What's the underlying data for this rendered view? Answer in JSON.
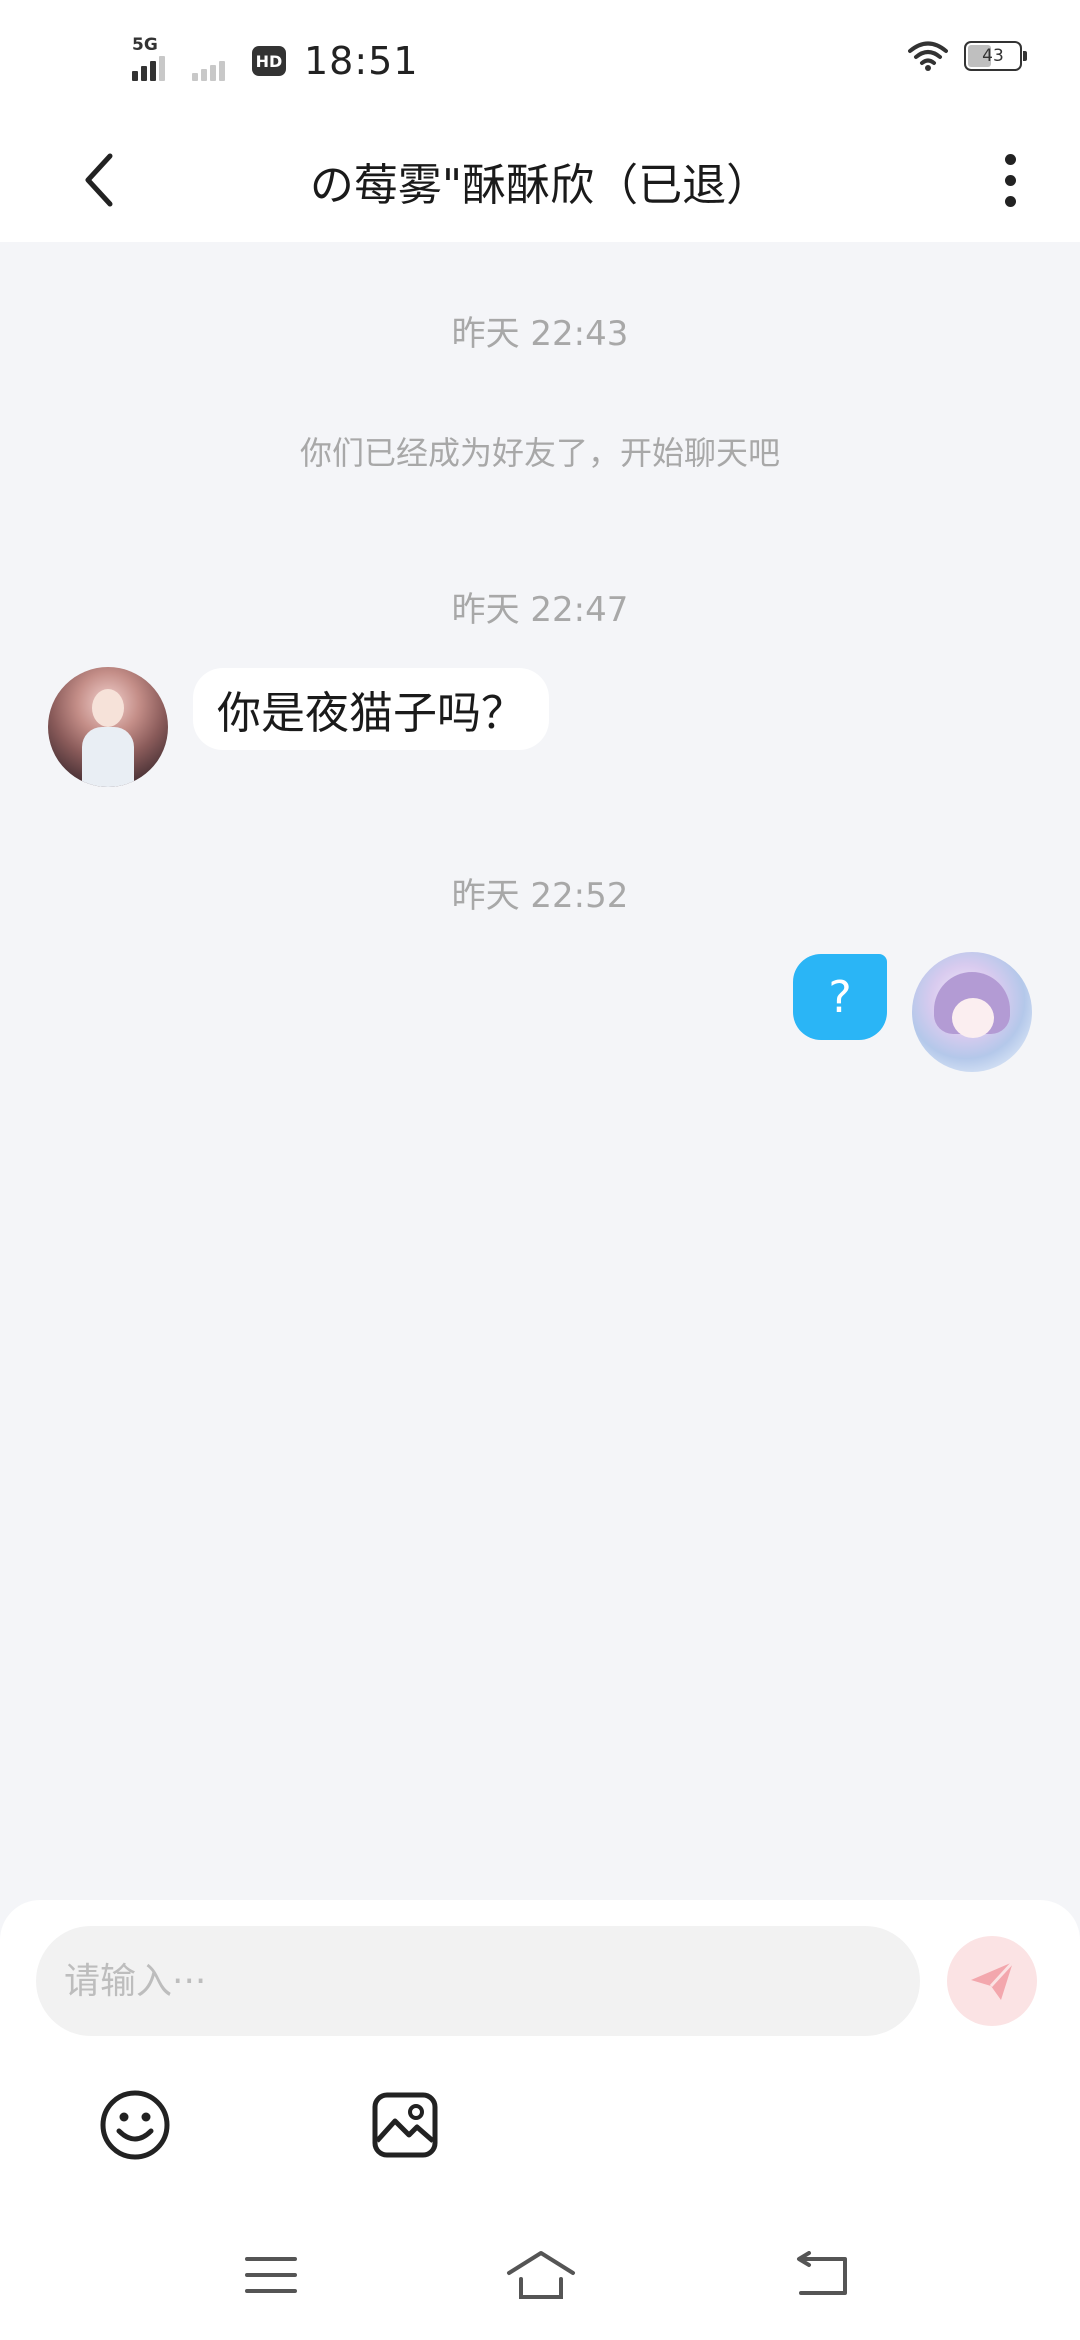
{
  "status_bar": {
    "network_label": "5G",
    "hd_label": "HD",
    "time": "18:51",
    "battery_level": "43",
    "battery_fraction": 0.43,
    "icons": [
      "signal-icon",
      "hd-icon",
      "wifi-icon",
      "battery-icon"
    ]
  },
  "header": {
    "title": "の莓雾\"酥酥欣（已退）",
    "back_icon": "back-arrow-icon",
    "more_icon": "more-vertical-icon"
  },
  "messages": [
    {
      "type": "timestamp",
      "text": "昨天 22:43"
    },
    {
      "type": "system",
      "text": "你们已经成为好友了，开始聊天吧"
    },
    {
      "type": "timestamp",
      "text": "昨天 22:47"
    },
    {
      "type": "incoming",
      "text": "你是夜猫子吗？"
    },
    {
      "type": "timestamp",
      "text": "昨天 22:52"
    },
    {
      "type": "outgoing",
      "text": "?"
    }
  ],
  "composer": {
    "placeholder": "请输入···",
    "value": "",
    "send_icon": "send-icon",
    "tools": [
      "emoji-icon",
      "image-icon"
    ]
  },
  "system_nav": [
    "menu-icon",
    "home-icon",
    "back-icon"
  ],
  "colors": {
    "background": "#f4f5f8",
    "outgoing_bubble": "#2ab5f6",
    "send_button": "#fbe3e4",
    "send_glyph": "#f3a7ad",
    "muted_text": "#a8a8a8"
  }
}
